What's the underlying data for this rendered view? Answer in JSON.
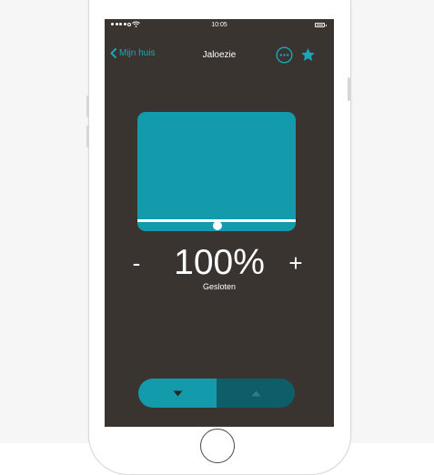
{
  "status_bar": {
    "time": "10:05"
  },
  "nav": {
    "back_label": "Mijn huis",
    "title": "Jaloezie",
    "icons": {
      "back": "chevron-left-icon",
      "more": "more-options-icon",
      "favorite": "star-icon"
    }
  },
  "blind": {
    "position_percent": 100,
    "colors": {
      "blind": "#139aab",
      "screen_bg": "#3a3431",
      "accent": "#1aa6b7"
    }
  },
  "controls": {
    "minus_label": "-",
    "plus_label": "+",
    "value_label": "100%",
    "status_label": "Gesloten"
  },
  "toggle": {
    "down_icon": "arrow-down-icon",
    "up_icon": "arrow-up-icon",
    "colors": {
      "down": "#139aab",
      "up": "#0e5e69"
    }
  }
}
